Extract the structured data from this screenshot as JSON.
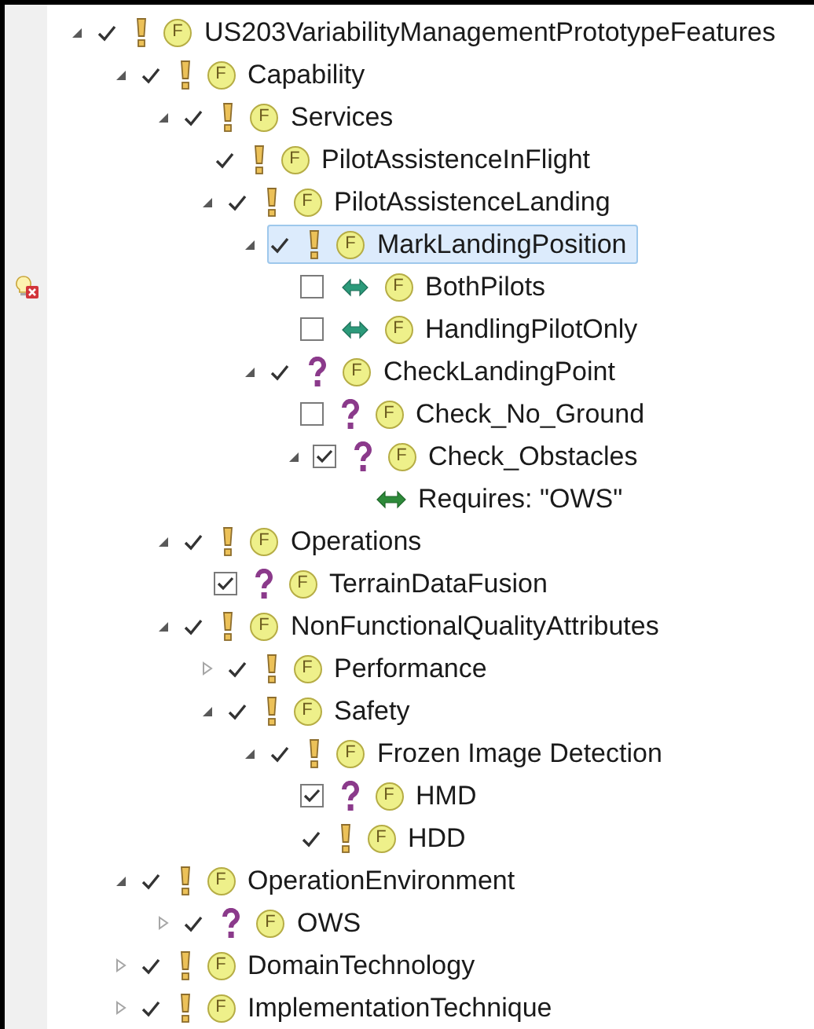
{
  "tree": [
    {
      "kind": "mandatory",
      "label": "US203VariabilityManagementPrototypeFeatures",
      "badge": "F",
      "expandable": true,
      "expanded": true,
      "checkbox": false,
      "checked": true,
      "selected": false,
      "problem": false,
      "children": [
        {
          "kind": "mandatory",
          "label": "Capability",
          "badge": "F",
          "expandable": true,
          "expanded": true,
          "checkbox": false,
          "checked": true,
          "selected": false,
          "problem": false,
          "children": [
            {
              "kind": "mandatory",
              "label": "Services",
              "badge": "F",
              "expandable": true,
              "expanded": true,
              "checkbox": false,
              "checked": true,
              "selected": false,
              "problem": false,
              "children": [
                {
                  "kind": "mandatory",
                  "label": "PilotAssistenceInFlight",
                  "badge": "F",
                  "expandable": false,
                  "checkbox": false,
                  "checked": true,
                  "selected": false,
                  "problem": false
                },
                {
                  "kind": "mandatory",
                  "label": "PilotAssistenceLanding",
                  "badge": "F",
                  "expandable": true,
                  "expanded": true,
                  "checkbox": false,
                  "checked": true,
                  "selected": false,
                  "problem": false,
                  "children": [
                    {
                      "kind": "mandatory",
                      "label": "MarkLandingPosition",
                      "badge": "F",
                      "expandable": true,
                      "expanded": true,
                      "checkbox": false,
                      "checked": true,
                      "selected": true,
                      "problem": false,
                      "children": [
                        {
                          "kind": "alternative",
                          "label": "BothPilots",
                          "badge": "F",
                          "expandable": false,
                          "checkbox": true,
                          "checked": false,
                          "selected": false,
                          "problem": true
                        },
                        {
                          "kind": "alternative",
                          "label": "HandlingPilotOnly",
                          "badge": "F",
                          "expandable": false,
                          "checkbox": true,
                          "checked": false,
                          "selected": false,
                          "problem": false
                        }
                      ]
                    },
                    {
                      "kind": "optional",
                      "label": "CheckLandingPoint",
                      "badge": "F",
                      "expandable": true,
                      "expanded": true,
                      "checkbox": false,
                      "checked": true,
                      "selected": false,
                      "problem": false,
                      "children": [
                        {
                          "kind": "optional",
                          "label": "Check_No_Ground",
                          "badge": "F",
                          "expandable": false,
                          "checkbox": true,
                          "checked": false,
                          "selected": false,
                          "problem": false
                        },
                        {
                          "kind": "optional",
                          "label": "Check_Obstacles",
                          "badge": "F",
                          "expandable": true,
                          "expanded": true,
                          "checkbox": true,
                          "checked": true,
                          "selected": false,
                          "problem": false,
                          "children": [
                            {
                              "kind": "constraint",
                              "label": "Requires: \"OWS\"",
                              "selected": false,
                              "problem": false
                            }
                          ]
                        }
                      ]
                    }
                  ]
                }
              ]
            },
            {
              "kind": "mandatory",
              "label": "Operations",
              "badge": "F",
              "expandable": true,
              "expanded": true,
              "checkbox": false,
              "checked": true,
              "selected": false,
              "problem": false,
              "children": [
                {
                  "kind": "optional",
                  "label": "TerrainDataFusion",
                  "badge": "F",
                  "expandable": false,
                  "checkbox": true,
                  "checked": true,
                  "selected": false,
                  "problem": false
                }
              ]
            },
            {
              "kind": "mandatory",
              "label": "NonFunctionalQualityAttributes",
              "badge": "F",
              "expandable": true,
              "expanded": true,
              "checkbox": false,
              "checked": true,
              "selected": false,
              "problem": false,
              "children": [
                {
                  "kind": "mandatory",
                  "label": "Performance",
                  "badge": "F",
                  "expandable": true,
                  "expanded": false,
                  "checkbox": false,
                  "checked": true,
                  "selected": false,
                  "problem": false
                },
                {
                  "kind": "mandatory",
                  "label": "Safety",
                  "badge": "F",
                  "expandable": true,
                  "expanded": true,
                  "checkbox": false,
                  "checked": true,
                  "selected": false,
                  "problem": false,
                  "children": [
                    {
                      "kind": "mandatory",
                      "label": "Frozen Image Detection",
                      "badge": "F",
                      "expandable": true,
                      "expanded": true,
                      "checkbox": false,
                      "checked": true,
                      "selected": false,
                      "problem": false,
                      "children": [
                        {
                          "kind": "optional",
                          "label": "HMD",
                          "badge": "F",
                          "expandable": false,
                          "checkbox": true,
                          "checked": true,
                          "selected": false,
                          "problem": false
                        },
                        {
                          "kind": "mandatory",
                          "label": "HDD",
                          "badge": "F",
                          "expandable": false,
                          "checkbox": false,
                          "checked": true,
                          "selected": false,
                          "problem": false
                        }
                      ]
                    }
                  ]
                }
              ]
            }
          ]
        },
        {
          "kind": "mandatory",
          "label": "OperationEnvironment",
          "badge": "F",
          "expandable": true,
          "expanded": true,
          "checkbox": false,
          "checked": true,
          "selected": false,
          "problem": false,
          "children": [
            {
              "kind": "optional",
              "label": "OWS",
              "badge": "F",
              "expandable": true,
              "expanded": false,
              "checkbox": false,
              "checked": true,
              "selected": false,
              "problem": false
            }
          ]
        },
        {
          "kind": "mandatory",
          "label": "DomainTechnology",
          "badge": "F",
          "expandable": true,
          "expanded": false,
          "checkbox": false,
          "checked": true,
          "selected": false,
          "problem": false
        },
        {
          "kind": "mandatory",
          "label": "ImplementationTechnique",
          "badge": "F",
          "expandable": true,
          "expanded": false,
          "checkbox": false,
          "checked": true,
          "selected": false,
          "problem": false
        }
      ]
    }
  ]
}
